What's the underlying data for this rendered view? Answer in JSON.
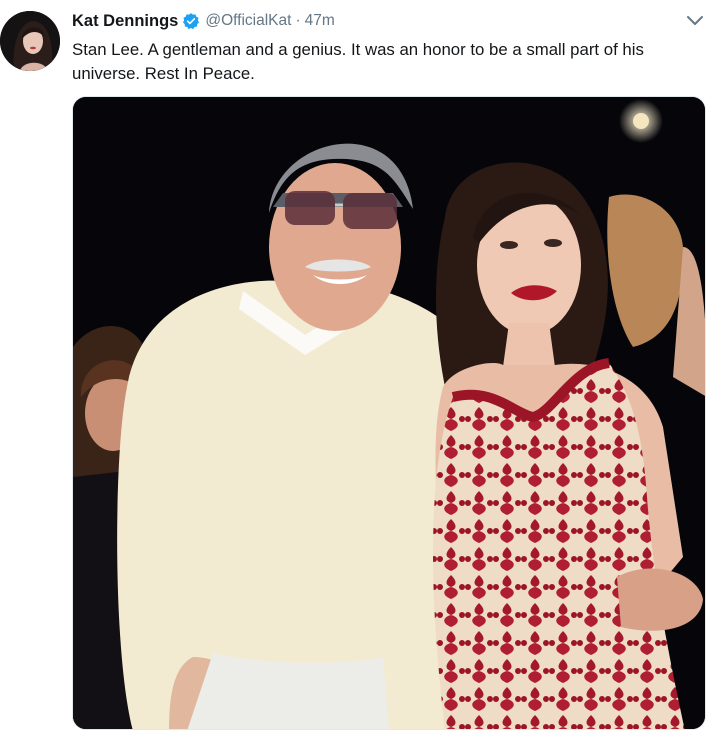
{
  "tweet": {
    "author_name": "Kat Dennings",
    "handle": "@OfficialKat",
    "separator": "·",
    "timestamp": "47m",
    "text": "Stan Lee. A gentleman and a genius. It was an honor to be a small part of his universe. Rest In Peace.",
    "verified": true
  },
  "icons": {
    "verified": "verified-badge-icon",
    "menu": "chevron-down-icon"
  },
  "colors": {
    "verified": "#1da1f2",
    "secondary_text": "#657786",
    "primary_text": "#14171a"
  }
}
